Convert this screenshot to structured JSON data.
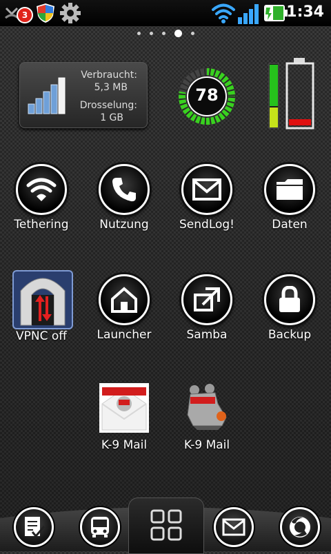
{
  "status_bar": {
    "time": "1:34",
    "notification_count": "3",
    "icons": [
      "missed-call-icon",
      "shield-icon",
      "gear-icon",
      "wifi-icon",
      "signal-icon",
      "battery-icon"
    ]
  },
  "page_indicator": {
    "pages": 5,
    "current": 4
  },
  "data_widget": {
    "used_label": "Verbraucht:",
    "used_value": "5,3 MB",
    "throttle_label": "Drosselung:",
    "throttle_value": "1 GB"
  },
  "battery_gauge": {
    "value": "78"
  },
  "apps_row1": [
    {
      "label": "Tethering",
      "icon": "wifi-icon"
    },
    {
      "label": "Nutzung",
      "icon": "phone-icon"
    },
    {
      "label": "SendLog!",
      "icon": "mail-icon"
    },
    {
      "label": "Daten",
      "icon": "folder-icon"
    }
  ],
  "apps_row2": [
    {
      "label": "VPNC off",
      "icon": "vpn-icon"
    },
    {
      "label": "Launcher",
      "icon": "home-icon"
    },
    {
      "label": "Samba",
      "icon": "external-window-icon"
    },
    {
      "label": "Backup",
      "icon": "lock-icon"
    }
  ],
  "apps_row3": [
    {
      "label": "K-9 Mail",
      "icon": "k9-mail-envelope-icon"
    },
    {
      "label": "K-9 Mail",
      "icon": "k9-mail-robot-icon"
    }
  ],
  "dock": [
    "checklist-icon",
    "bus-icon",
    "app-drawer-icon",
    "mail-icon",
    "firefox-icon"
  ],
  "colors": {
    "accent_green": "#39d11f",
    "battery_red": "#e01010",
    "badge_red": "#e0241b"
  }
}
